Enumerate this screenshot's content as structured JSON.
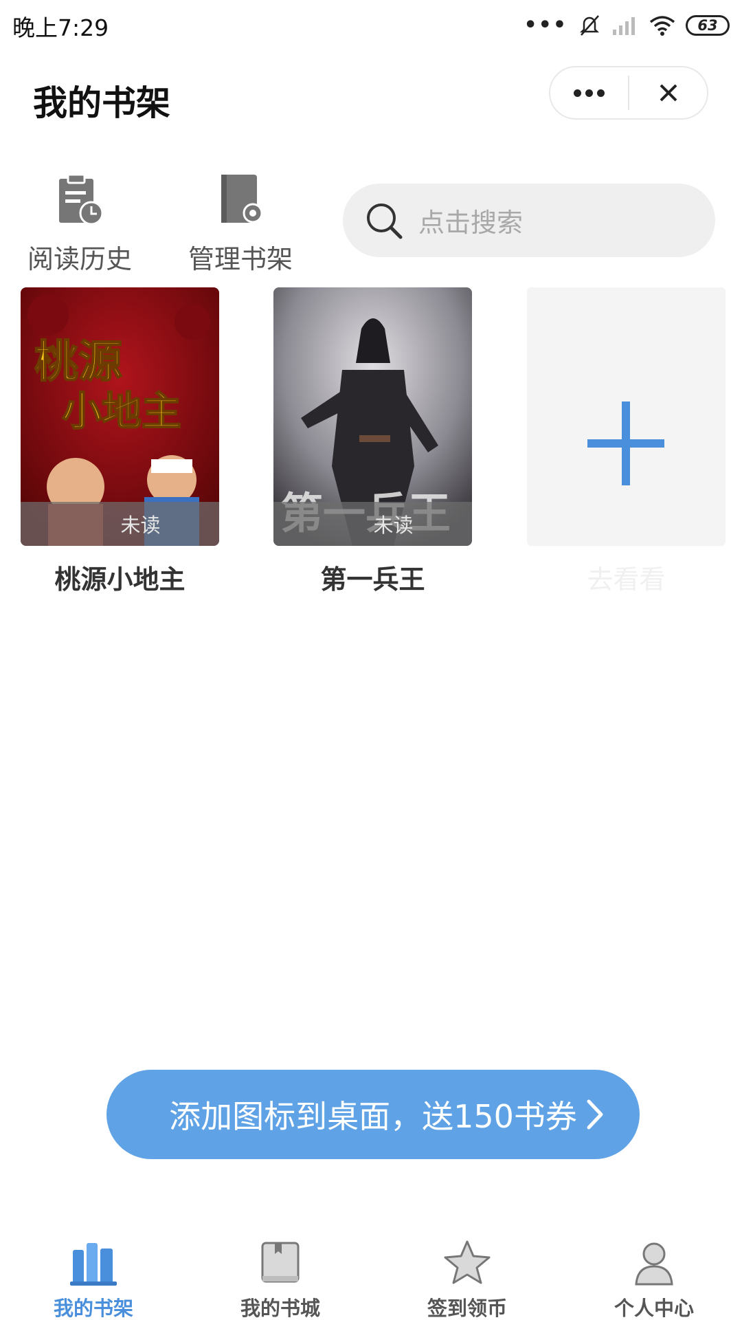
{
  "status_bar": {
    "time": "晚上7:29",
    "battery": "63"
  },
  "header": {
    "title": "我的书架",
    "capsule": {
      "more_icon": "more-dots-icon",
      "close_icon": "close-icon"
    }
  },
  "toolbar": {
    "history_label": "阅读历史",
    "manage_label": "管理书架",
    "search_placeholder": "点击搜索"
  },
  "books": [
    {
      "title": "桃源小地主",
      "status": "未读",
      "cover_text": [
        "桃源",
        "小地主"
      ]
    },
    {
      "title": "第一兵王",
      "status": "未读",
      "cover_text": "第一兵王"
    }
  ],
  "add_book": {
    "label": "去看看"
  },
  "promo": {
    "text": "添加图标到桌面，送150书券"
  },
  "tabs": [
    {
      "label": "我的书架",
      "active": true
    },
    {
      "label": "我的书城",
      "active": false
    },
    {
      "label": "签到领币",
      "active": false
    },
    {
      "label": "个人中心",
      "active": false
    }
  ],
  "colors": {
    "accent": "#4a8fdb",
    "promo_bg": "#5fa3e6",
    "search_bg": "#efefef"
  }
}
